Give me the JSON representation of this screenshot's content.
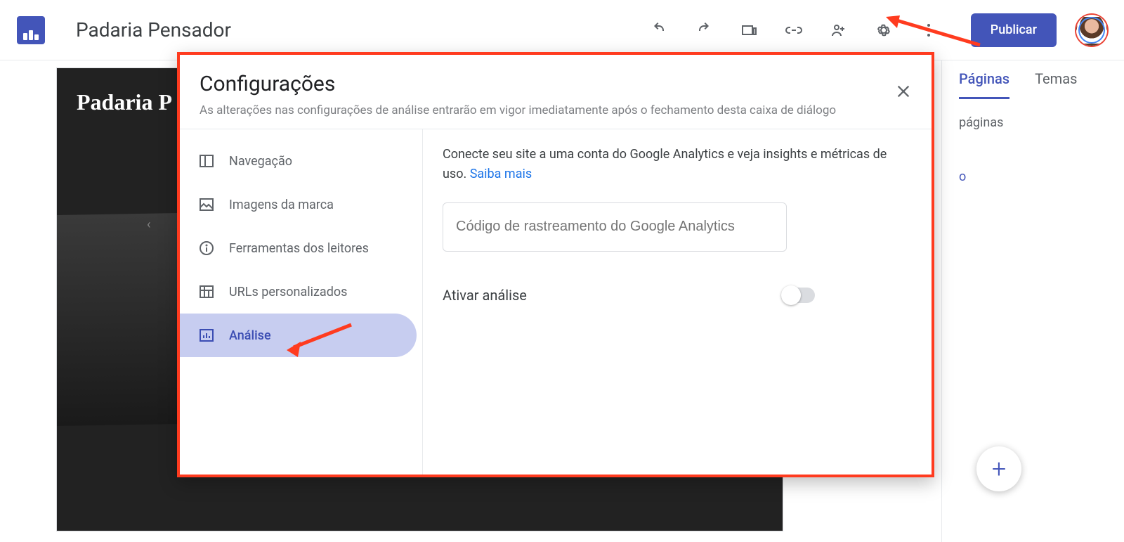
{
  "header": {
    "site_title": "Padaria Pensador",
    "publish_label": "Publicar"
  },
  "canvas": {
    "title": "Padaria P"
  },
  "right_panel": {
    "tabs": {
      "pages": "Páginas",
      "themes": "Temas"
    },
    "filter_placeholder": "páginas",
    "link_fragment": "o"
  },
  "dialog": {
    "title": "Configurações",
    "subtitle": "As alterações nas configurações de análise entrarão em vigor imediatamente após o fechamento desta caixa de diálogo",
    "nav": {
      "navigation": "Navegação",
      "brand": "Imagens da marca",
      "readers": "Ferramentas dos leitores",
      "urls": "URLs personalizados",
      "analytics": "Análise"
    },
    "content": {
      "desc_prefix": "Conecte seu site a uma conta do Google Analytics e veja insights e métricas de uso. ",
      "learn_more": "Saiba mais",
      "input_placeholder": "Código de rastreamento do Google Analytics",
      "toggle_label": "Ativar análise"
    }
  }
}
